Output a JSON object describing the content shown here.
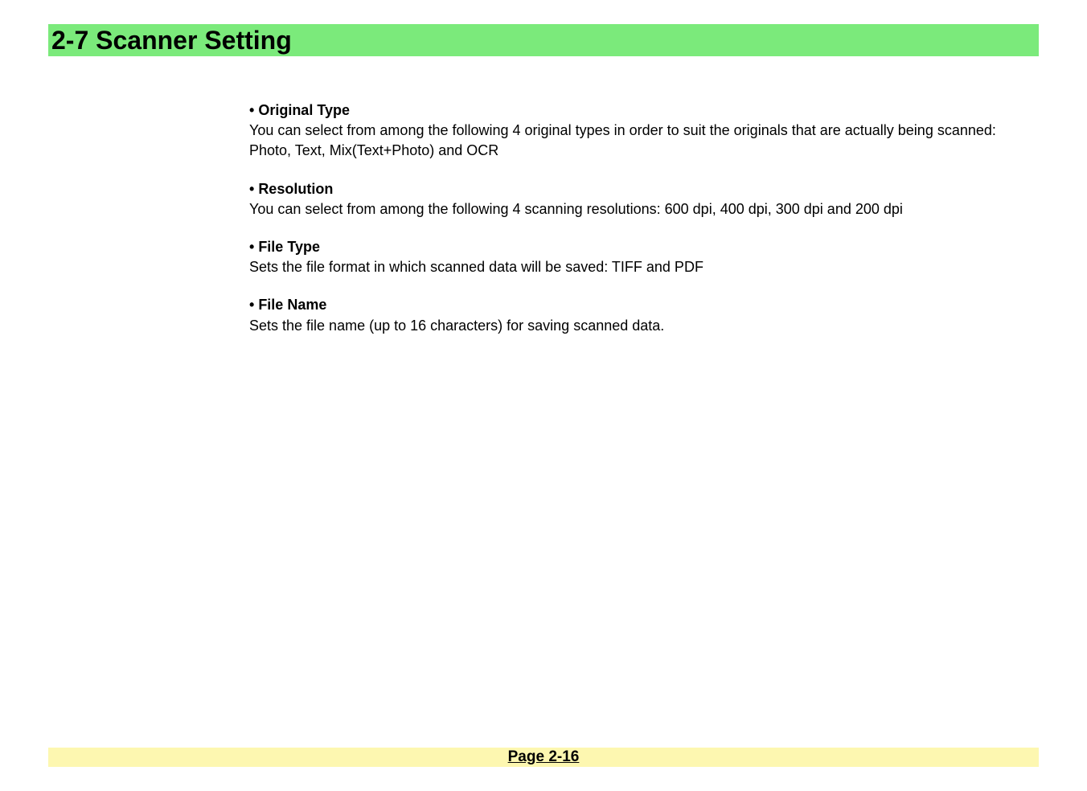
{
  "header": {
    "title": "2-7  Scanner Setting"
  },
  "items": [
    {
      "title": "Original Type",
      "desc": "You can select from among the following 4 original types in order to suit the originals that are actually being scanned: Photo, Text, Mix(Text+Photo) and OCR"
    },
    {
      "title": "Resolution",
      "desc": "You can select from among the following 4 scanning resolutions: 600 dpi, 400 dpi, 300 dpi and 200 dpi"
    },
    {
      "title": "File Type",
      "desc": "Sets the file format in which scanned data will be saved: TIFF and PDF"
    },
    {
      "title": "File Name",
      "desc": "Sets the file name (up to 16 characters) for saving scanned data."
    }
  ],
  "footer": {
    "page": "Page 2-16"
  }
}
